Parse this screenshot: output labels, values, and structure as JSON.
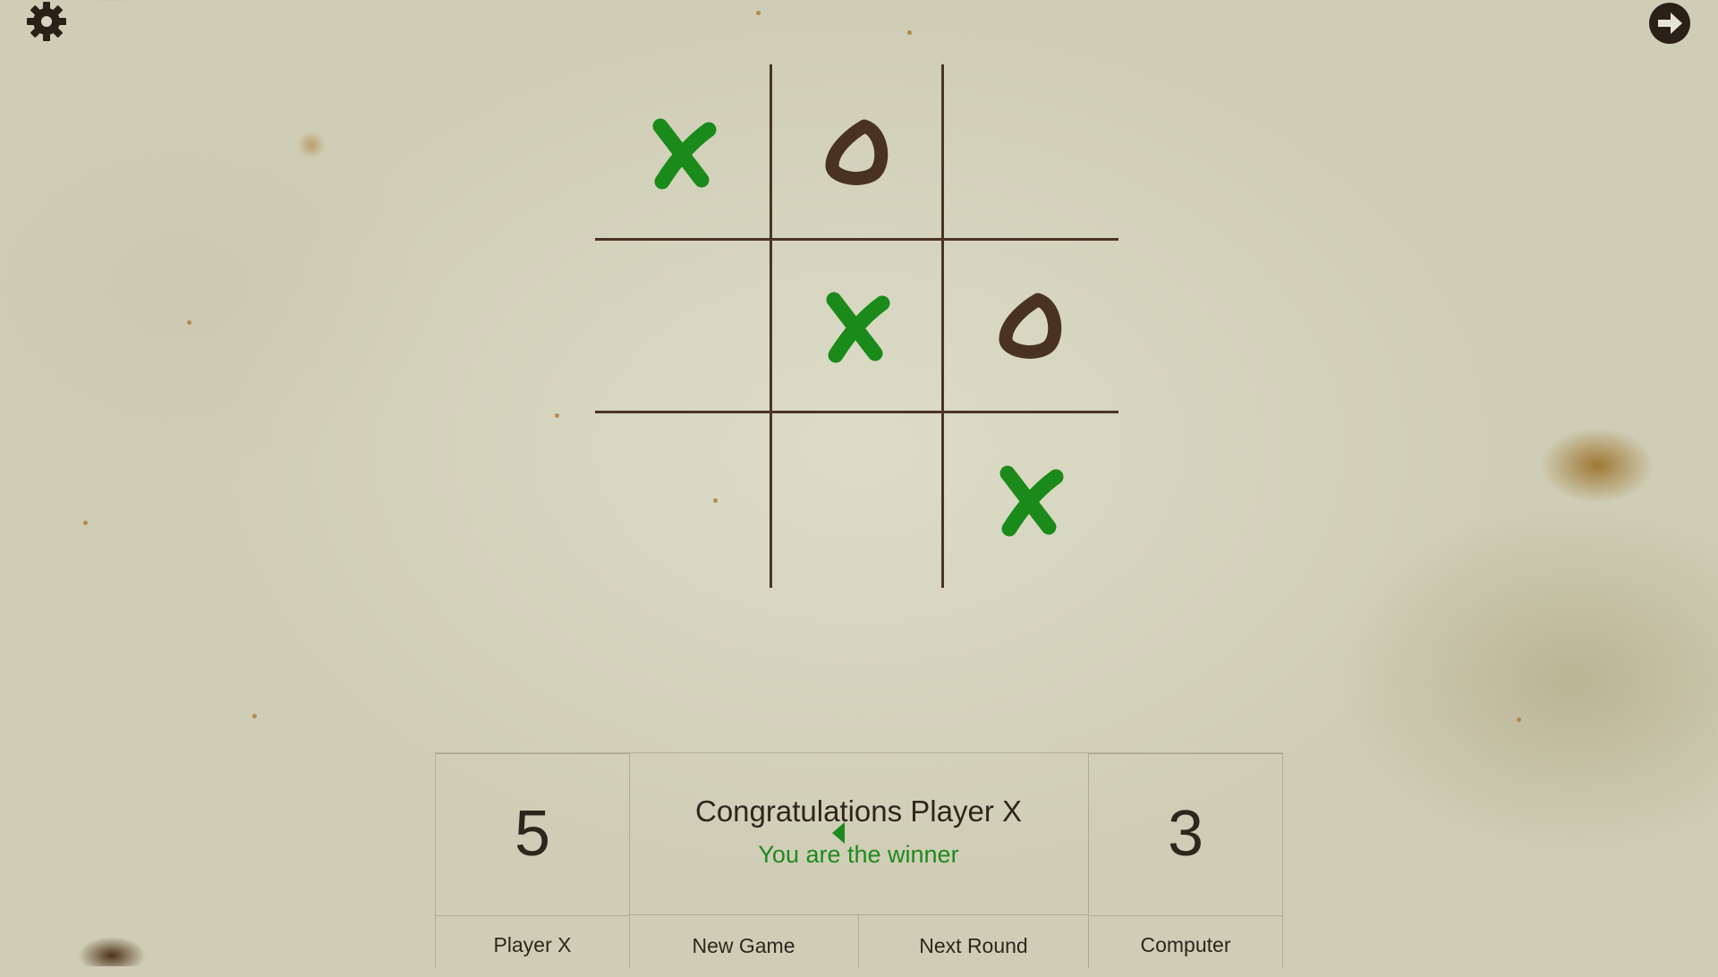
{
  "toolbar": {
    "settings_icon": "gear-icon",
    "exit_icon": "arrow-right-circle-icon"
  },
  "board": {
    "cells": [
      "X",
      "O",
      "",
      "",
      "X",
      "O",
      "",
      "",
      "X"
    ],
    "x_color": "#1a8a1a",
    "o_color": "#4a3221",
    "line_color": "#4a3525"
  },
  "scoreboard": {
    "player_x": {
      "score": "5",
      "label": "Player X"
    },
    "computer": {
      "score": "3",
      "label": "Computer"
    },
    "message": {
      "title": "Congratulations Player X",
      "subtitle": "You are the winner"
    },
    "turn_indicator_icon": "triangle-left-icon",
    "buttons": {
      "new_game": "New Game",
      "next_round": "Next Round"
    }
  }
}
